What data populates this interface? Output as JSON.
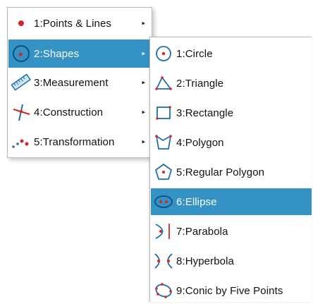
{
  "main_menu": {
    "items": [
      {
        "label": "1:Points & Lines",
        "icon": "point-icon",
        "has_submenu": true
      },
      {
        "label": "2:Shapes",
        "icon": "shapes-icon",
        "has_submenu": true,
        "selected": true
      },
      {
        "label": "3:Measurement",
        "icon": "ruler-icon",
        "has_submenu": true
      },
      {
        "label": "4:Construction",
        "icon": "construction-icon",
        "has_submenu": true
      },
      {
        "label": "5:Transformation",
        "icon": "transformation-icon",
        "has_submenu": true
      }
    ],
    "arrow": "▸"
  },
  "shapes_submenu": {
    "items": [
      {
        "label": "1:Circle",
        "icon": "circle-icon"
      },
      {
        "label": "2:Triangle",
        "icon": "triangle-icon"
      },
      {
        "label": "3:Rectangle",
        "icon": "rectangle-icon"
      },
      {
        "label": "4:Polygon",
        "icon": "polygon-icon"
      },
      {
        "label": "5:Regular Polygon",
        "icon": "regular-polygon-icon"
      },
      {
        "label": "6:Ellipse",
        "icon": "ellipse-icon",
        "selected": true
      },
      {
        "label": "7:Parabola",
        "icon": "parabola-icon"
      },
      {
        "label": "8:Hyperbola",
        "icon": "hyperbola-icon"
      },
      {
        "label": "9:Conic by Five Points",
        "icon": "conic-five-points-icon"
      }
    ]
  },
  "colors": {
    "selection": "#3592c4",
    "icon_blue": "#1f6fa8",
    "icon_red": "#d42626"
  }
}
